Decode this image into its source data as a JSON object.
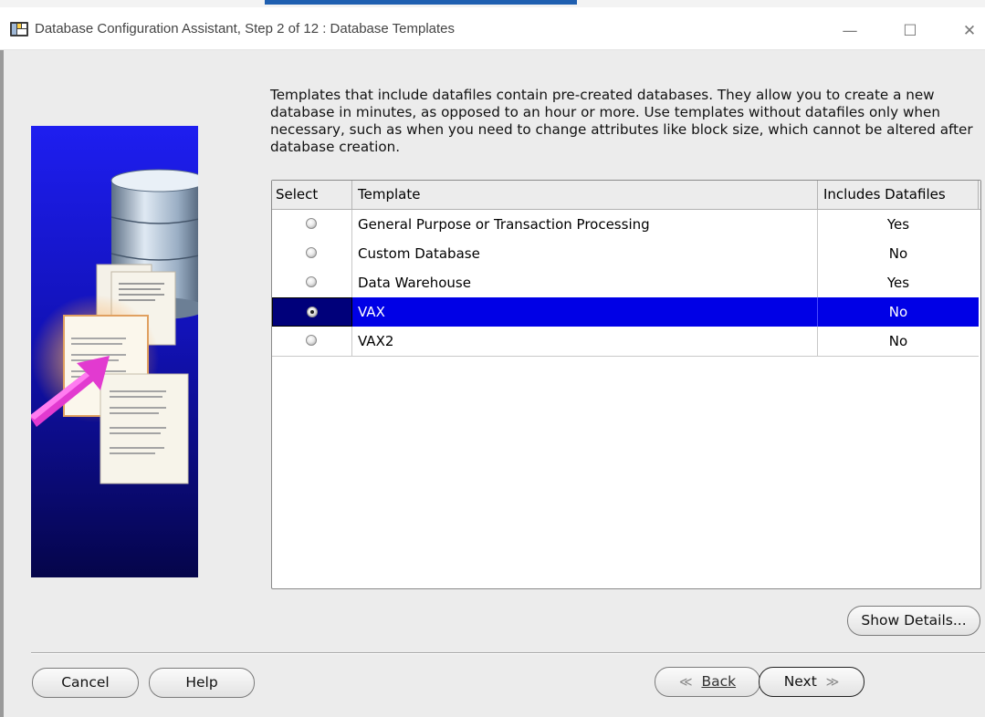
{
  "window": {
    "title": "Database Configuration Assistant, Step 2 of 12 : Database Templates",
    "controls": {
      "minimize": "—",
      "maximize": "☐",
      "close": "✕"
    }
  },
  "description": "Templates that include datafiles contain pre-created databases. They allow you to create a new database in minutes, as opposed to an hour or more. Use templates without datafiles only when necessary, such as when you need to change attributes like block size, which cannot be altered after database creation.",
  "table": {
    "columns": [
      "Select",
      "Template",
      "Includes Datafiles"
    ],
    "rows": [
      {
        "template": "General Purpose or Transaction Processing",
        "includes": "Yes",
        "selected": false
      },
      {
        "template": "Custom Database",
        "includes": "No",
        "selected": false
      },
      {
        "template": "Data Warehouse",
        "includes": "Yes",
        "selected": false
      },
      {
        "template": "VAX",
        "includes": "No",
        "selected": true
      },
      {
        "template": "VAX2",
        "includes": "No",
        "selected": false
      }
    ]
  },
  "buttons": {
    "show_details": "Show Details...",
    "cancel": "Cancel",
    "help": "Help",
    "back": "Back",
    "next": "Next",
    "back_arrow": "≪",
    "next_arrow": "≫"
  },
  "colors": {
    "selection": "#0000e6",
    "panel": "#ececec"
  },
  "illustration": {
    "icon": "database-templates-illustration"
  }
}
